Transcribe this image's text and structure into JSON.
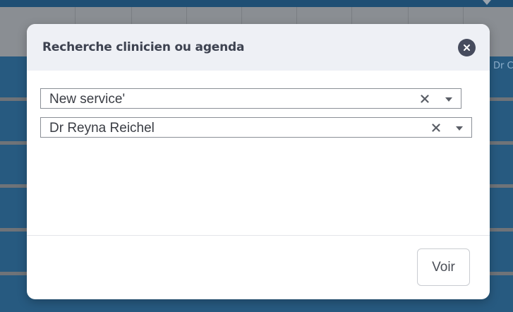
{
  "background": {
    "side_text": "Dr C"
  },
  "modal": {
    "title": "Recherche clinicien ou agenda",
    "close_icon": "close-icon",
    "service_select": {
      "value": "New service'"
    },
    "clinician_select": {
      "value": "Dr Reyna Reichel"
    },
    "submit_label": "Voir"
  },
  "colors": {
    "header_bg": "#eef0f5",
    "title_text": "#3d4250",
    "close_button_bg": "#464b5d",
    "backdrop_rows": "#275a80"
  }
}
